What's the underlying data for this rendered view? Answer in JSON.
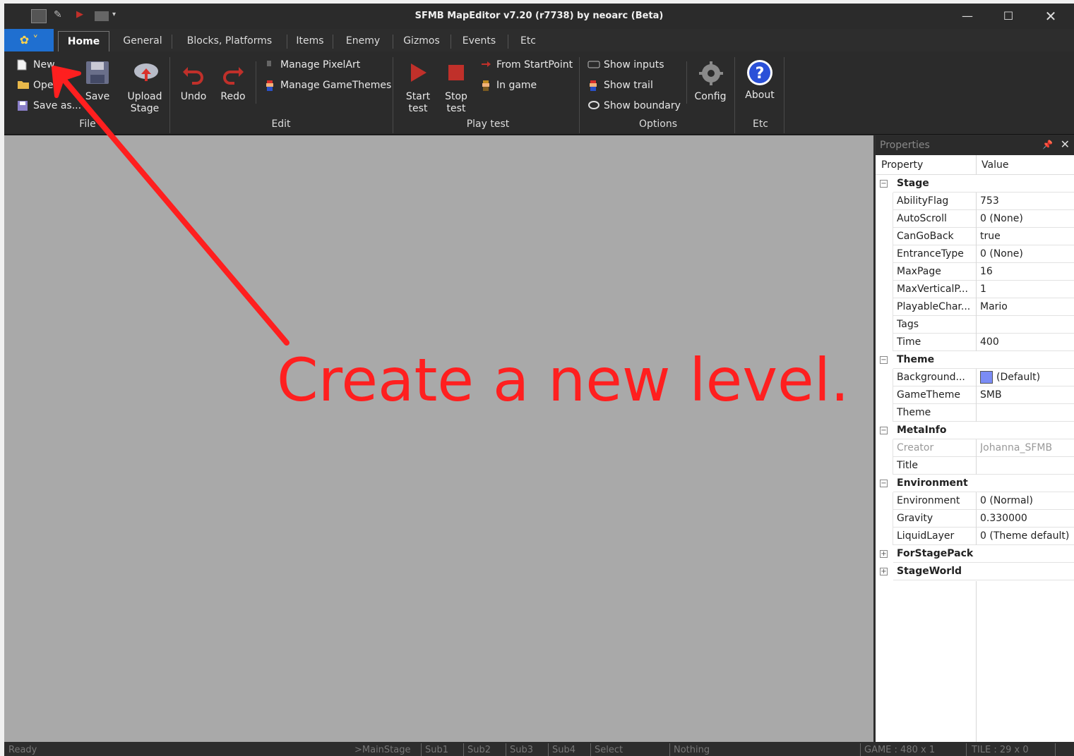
{
  "window": {
    "title": "SFMB MapEditor v7.20 (r7738) by neoarc (Beta)",
    "controls": {
      "minimize": "—",
      "maximize": "☐",
      "close": "✕"
    }
  },
  "tabs": [
    "Home",
    "General",
    "Blocks, Platforms",
    "Items",
    "Enemy",
    "Gizmos",
    "Events",
    "Etc"
  ],
  "ribbon": {
    "file": {
      "new": "New",
      "open": "Ope",
      "save_as": "Save as...",
      "save": "Save",
      "upload_line1": "Upload",
      "upload_line2": "Stage",
      "label": "File"
    },
    "edit": {
      "undo": "Undo",
      "redo": "Redo",
      "manage_pixelart": "Manage PixelArt",
      "manage_gamethemes": "Manage GameThemes",
      "label": "Edit"
    },
    "playtest": {
      "start_line1": "Start",
      "start_line2": "test",
      "stop_line1": "Stop",
      "stop_line2": "test",
      "from_startpoint": "From StartPoint",
      "in_game": "In game",
      "label": "Play test"
    },
    "options": {
      "show_inputs": "Show inputs",
      "show_trail": "Show trail",
      "show_boundary": "Show boundary",
      "config": "Config",
      "label": "Options"
    },
    "etc": {
      "about": "About",
      "label": "Etc"
    }
  },
  "properties": {
    "panel_title": "Properties",
    "col_property": "Property",
    "col_value": "Value",
    "rows": [
      {
        "type": "cat",
        "name": "Stage",
        "expanded": true
      },
      {
        "type": "prop",
        "name": "AbilityFlag",
        "value": "753"
      },
      {
        "type": "prop",
        "name": "AutoScroll",
        "value": "0 (None)"
      },
      {
        "type": "prop",
        "name": "CanGoBack",
        "value": "true"
      },
      {
        "type": "prop",
        "name": "EntranceType",
        "value": "0 (None)"
      },
      {
        "type": "prop",
        "name": "MaxPage",
        "value": "16"
      },
      {
        "type": "prop",
        "name": "MaxVerticalP...",
        "value": "1"
      },
      {
        "type": "prop",
        "name": "PlayableChar...",
        "value": "Mario"
      },
      {
        "type": "prop",
        "name": "Tags",
        "value": ""
      },
      {
        "type": "prop",
        "name": "Time",
        "value": "400"
      },
      {
        "type": "cat",
        "name": "Theme",
        "expanded": true
      },
      {
        "type": "prop",
        "name": "Background...",
        "value": "(Default)",
        "swatch": "#7b8cf5"
      },
      {
        "type": "prop",
        "name": "GameTheme",
        "value": "SMB"
      },
      {
        "type": "prop",
        "name": "Theme",
        "value": ""
      },
      {
        "type": "cat",
        "name": "MetaInfo",
        "expanded": true
      },
      {
        "type": "prop",
        "name": "Creator",
        "value": "Johanna_SFMB",
        "dim": true
      },
      {
        "type": "prop",
        "name": "Title",
        "value": ""
      },
      {
        "type": "cat",
        "name": "Environment",
        "expanded": true
      },
      {
        "type": "prop",
        "name": "Environment",
        "value": "0 (Normal)"
      },
      {
        "type": "prop",
        "name": "Gravity",
        "value": "0.330000"
      },
      {
        "type": "prop",
        "name": "LiquidLayer",
        "value": "0 (Theme default)"
      },
      {
        "type": "cat",
        "name": "ForStagePack",
        "expanded": false
      },
      {
        "type": "cat",
        "name": "StageWorld",
        "expanded": false
      }
    ]
  },
  "statusbar": {
    "ready": "Ready",
    "main_stage": ">MainStage",
    "sub1": "Sub1",
    "sub2": "Sub2",
    "sub3": "Sub3",
    "sub4": "Sub4",
    "select": "Select",
    "nothing": "Nothing",
    "game_coords": "GAME : 480 x 1",
    "tile_coords": "TILE : 29 x 0"
  },
  "annotation": {
    "text": "Create a new level.",
    "color": "#ff1f1f"
  },
  "colors": {
    "accent": "#1f6fd0",
    "dark_bg": "#2b2b2b",
    "canvas": "#a9a9a9"
  }
}
